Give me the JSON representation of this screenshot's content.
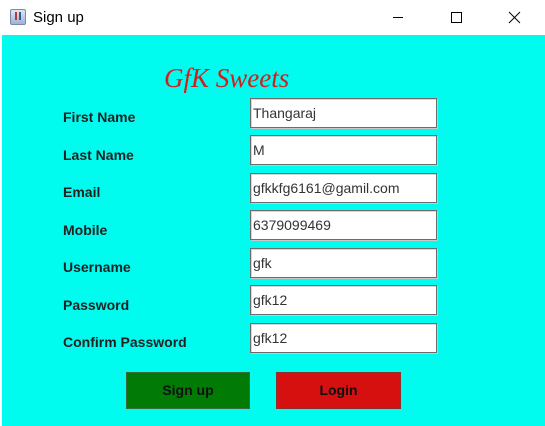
{
  "window": {
    "title": "Sign up"
  },
  "brand": {
    "name": "GfK Sweets",
    "color": "#d61c1c"
  },
  "colors": {
    "background": "#00fbef",
    "signup_button": "#027a06",
    "login_button": "#d60f0f"
  },
  "icons": {
    "app": "java-app-icon",
    "minimize": "minimize-icon",
    "maximize": "maximize-icon",
    "close": "close-icon"
  },
  "form": {
    "first_name": {
      "label": "First Name",
      "value": "Thangaraj"
    },
    "last_name": {
      "label": "Last Name",
      "value": "M"
    },
    "email": {
      "label": "Email",
      "value": "gfkkfg6161@gamil.com"
    },
    "mobile": {
      "label": "Mobile",
      "value": "6379099469"
    },
    "username": {
      "label": "Username",
      "value": "gfk"
    },
    "password": {
      "label": "Password",
      "value": "gfk12"
    },
    "confirm_password": {
      "label": "Confirm Password",
      "value": "gfk12"
    }
  },
  "buttons": {
    "signup": "Sign up",
    "login": "Login"
  }
}
